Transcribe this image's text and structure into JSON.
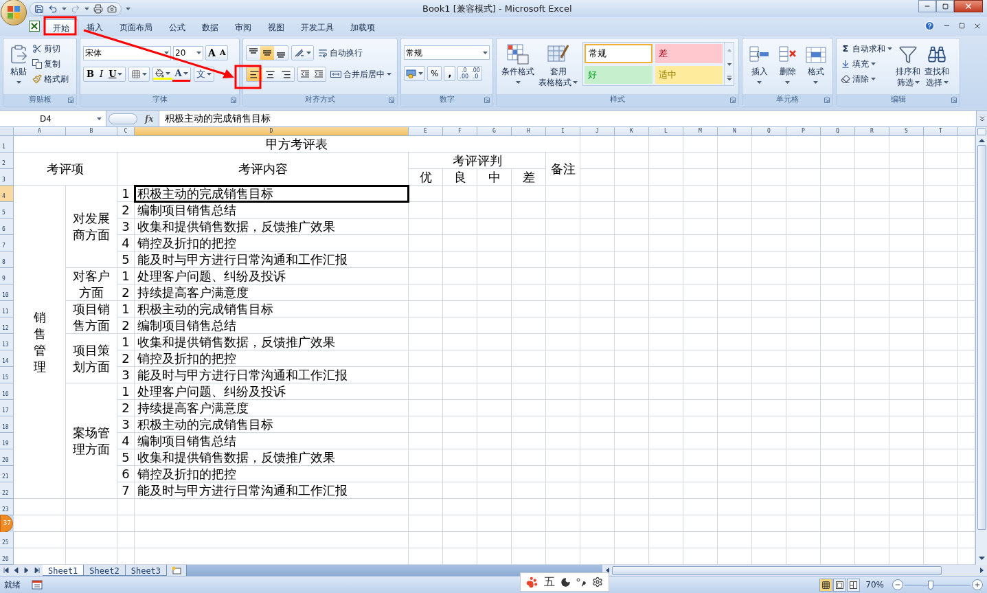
{
  "title_bar": {
    "title": "Book1  [兼容模式] - Microsoft Excel"
  },
  "ribbon_tabs": [
    {
      "label": "开始",
      "selected": true
    },
    {
      "label": "插入",
      "selected": false
    },
    {
      "label": "页面布局",
      "selected": false
    },
    {
      "label": "公式",
      "selected": false
    },
    {
      "label": "数据",
      "selected": false
    },
    {
      "label": "审阅",
      "selected": false
    },
    {
      "label": "视图",
      "selected": false
    },
    {
      "label": "开发工具",
      "selected": false
    },
    {
      "label": "加载项",
      "selected": false
    }
  ],
  "ribbon": {
    "clipboard": {
      "label": "剪贴板",
      "paste": "粘贴",
      "cut": "剪切",
      "copy": "复制",
      "format_painter": "格式刷"
    },
    "font": {
      "label": "字体",
      "font_name": "宋体",
      "font_size": "20",
      "grow": "A",
      "shrink": "A",
      "bold": "B",
      "italic": "I",
      "underline": "U",
      "font_color": "A",
      "phonetic": "文"
    },
    "alignment": {
      "label": "对齐方式",
      "vertical": [
        {
          "kind": "top",
          "selected": false
        },
        {
          "kind": "middle",
          "selected": true
        },
        {
          "kind": "bottom",
          "selected": false
        }
      ],
      "horizontal": [
        {
          "kind": "left",
          "selected": true
        },
        {
          "kind": "center",
          "selected": false
        },
        {
          "kind": "right",
          "selected": false
        }
      ],
      "wrap_text": "自动换行",
      "merge": "合并后居中"
    },
    "number": {
      "label": "数字",
      "format": "常规",
      "percent": "%",
      "comma": ",",
      "inc_decimal": [
        ".0",
        ".00"
      ],
      "dec_decimal": [
        ".00",
        ".0"
      ]
    },
    "styles": {
      "label": "样式",
      "conditional": "条件格式",
      "table_format": [
        "套用",
        "表格格式"
      ],
      "gallery": [
        {
          "label": "常规",
          "selected": true,
          "color": "#ffffff"
        },
        {
          "label": "差",
          "selected": false,
          "color": "#ffc7ce"
        },
        {
          "label": "好",
          "selected": false,
          "color": "#c6efce"
        },
        {
          "label": "适中",
          "selected": false,
          "color": "#ffeb9c"
        }
      ]
    },
    "cells": {
      "label": "单元格",
      "insert": "插入",
      "delete": "删除",
      "format": "格式"
    },
    "editing": {
      "label": "编辑",
      "sigma": "Σ",
      "autosum": "自动求和",
      "fill": "填充",
      "clear": "清除",
      "sort": [
        "排序和",
        "筛选"
      ],
      "find": [
        "查找和",
        "选择"
      ]
    }
  },
  "formula_bar": {
    "name_box": "D4",
    "fx": "fx",
    "value": "积极主动的完成销售目标"
  },
  "columns": [
    "A",
    "B",
    "C",
    "D",
    "E",
    "F",
    "G",
    "H",
    "I",
    "J",
    "K",
    "L",
    "M",
    "N",
    "O",
    "P",
    "Q",
    "R",
    "S",
    "T"
  ],
  "row_headers": [
    {
      "label": "1"
    },
    {
      "label": "2"
    },
    {
      "label": "3"
    },
    {
      "label": "4"
    },
    {
      "label": "5"
    },
    {
      "label": "6"
    },
    {
      "label": "7"
    },
    {
      "label": "8"
    },
    {
      "label": "9"
    },
    {
      "label": "10"
    },
    {
      "label": "11"
    },
    {
      "label": "12"
    },
    {
      "label": "13"
    },
    {
      "label": "14"
    },
    {
      "label": "15"
    },
    {
      "label": "16"
    },
    {
      "label": "17"
    },
    {
      "label": "18"
    },
    {
      "label": "19"
    },
    {
      "label": "20"
    },
    {
      "label": "21"
    },
    {
      "label": "22"
    },
    {
      "label": "23"
    },
    {
      "badge": "37"
    },
    {
      "label": "25"
    },
    {
      "label": "26"
    }
  ],
  "sheet": {
    "title": "甲方考评表",
    "item_header": "考评项",
    "content_header": "考评内容",
    "judgement_header": "考评评判",
    "grades": [
      "优",
      "良",
      "中",
      "差"
    ],
    "notes_header": "备注",
    "section": {
      "label": "销售管理",
      "groups": [
        {
          "label": "对发展商方面",
          "items": [
            {
              "no": "1",
              "text": "积极主动的完成销售目标",
              "selected": true
            },
            {
              "no": "2",
              "text": "编制项目销售总结",
              "selected": false
            },
            {
              "no": "3",
              "text": "收集和提供销售数据，反馈推广效果",
              "selected": false
            },
            {
              "no": "4",
              "text": "销控及折扣的把控",
              "selected": false
            },
            {
              "no": "5",
              "text": "能及时与甲方进行日常沟通和工作汇报",
              "selected": false
            }
          ]
        },
        {
          "label": "对客户方面",
          "items": [
            {
              "no": "1",
              "text": "处理客户问题、纠纷及投诉",
              "selected": false
            },
            {
              "no": "2",
              "text": "持续提高客户满意度",
              "selected": false
            }
          ]
        },
        {
          "label": "项目销售方面",
          "items": [
            {
              "no": "1",
              "text": "积极主动的完成销售目标",
              "selected": false
            },
            {
              "no": "2",
              "text": "编制项目销售总结",
              "selected": false
            }
          ]
        },
        {
          "label": "项目策划方面",
          "items": [
            {
              "no": "1",
              "text": "收集和提供销售数据，反馈推广效果",
              "selected": false
            },
            {
              "no": "2",
              "text": "销控及折扣的把控",
              "selected": false
            },
            {
              "no": "3",
              "text": "能及时与甲方进行日常沟通和工作汇报",
              "selected": false
            }
          ]
        },
        {
          "label": "案场管理方面",
          "items": [
            {
              "no": "1",
              "text": "处理客户问题、纠纷及投诉",
              "selected": false
            },
            {
              "no": "2",
              "text": "持续提高客户满意度",
              "selected": false
            },
            {
              "no": "3",
              "text": "积极主动的完成销售目标",
              "selected": false
            },
            {
              "no": "4",
              "text": "编制项目销售总结",
              "selected": false
            },
            {
              "no": "5",
              "text": "收集和提供销售数据，反馈推广效果",
              "selected": false
            },
            {
              "no": "6",
              "text": "销控及折扣的把控",
              "selected": false
            },
            {
              "no": "7",
              "text": "能及时与甲方进行日常沟通和工作汇报",
              "selected": false
            }
          ]
        }
      ]
    }
  },
  "sheet_tabs": [
    {
      "label": "Sheet1",
      "selected": true
    },
    {
      "label": "Sheet2",
      "selected": false
    },
    {
      "label": "Sheet3",
      "selected": false
    }
  ],
  "status_bar": {
    "status": "就绪",
    "view_buttons": [
      {
        "kind": "normal",
        "selected": true
      },
      {
        "kind": "page_layout",
        "selected": false
      },
      {
        "kind": "page_break",
        "selected": false
      }
    ],
    "zoom": "70%",
    "zoom_slider": {
      "level": 0.4
    }
  },
  "ime_toolbar": {
    "mode": "五"
  }
}
